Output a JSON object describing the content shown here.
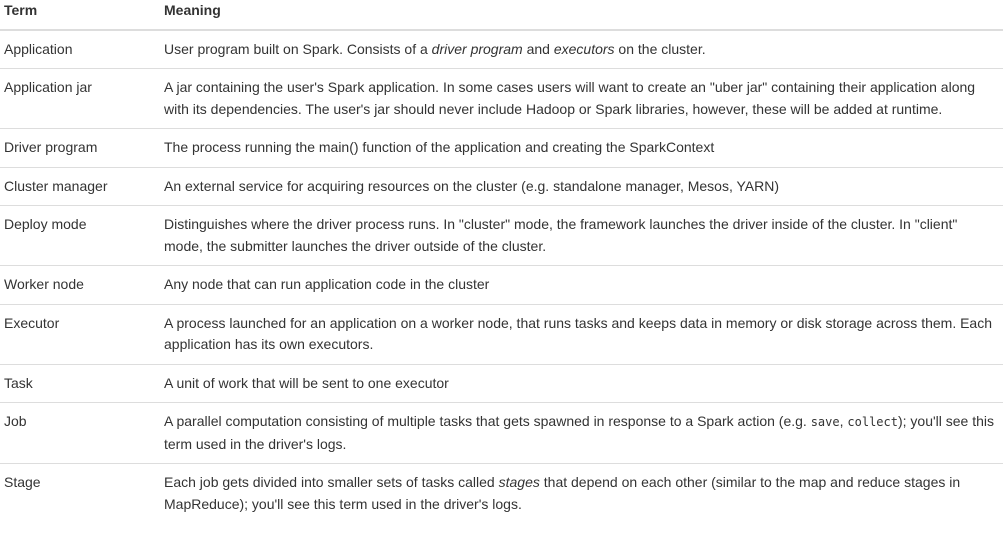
{
  "header": {
    "term": "Term",
    "meaning": "Meaning"
  },
  "rows": [
    {
      "term": "Application",
      "meaning": [
        {
          "text": "User program built on Spark. Consists of a "
        },
        {
          "text": "driver program",
          "em": true
        },
        {
          "text": " and "
        },
        {
          "text": "executors",
          "em": true
        },
        {
          "text": " on the cluster."
        }
      ]
    },
    {
      "term": "Application jar",
      "meaning": [
        {
          "text": "A jar containing the user's Spark application. In some cases users will want to create an \"uber jar\" containing their application along with its dependencies. The user's jar should never include Hadoop or Spark libraries, however, these will be added at runtime."
        }
      ]
    },
    {
      "term": "Driver program",
      "meaning": [
        {
          "text": "The process running the main() function of the application and creating the SparkContext"
        }
      ]
    },
    {
      "term": "Cluster manager",
      "meaning": [
        {
          "text": "An external service for acquiring resources on the cluster (e.g. standalone manager, Mesos, YARN)"
        }
      ]
    },
    {
      "term": "Deploy mode",
      "meaning": [
        {
          "text": "Distinguishes where the driver process runs. In \"cluster\" mode, the framework launches the driver inside of the cluster. In \"client\" mode, the submitter launches the driver outside of the cluster."
        }
      ]
    },
    {
      "term": "Worker node",
      "meaning": [
        {
          "text": "Any node that can run application code in the cluster"
        }
      ]
    },
    {
      "term": "Executor",
      "meaning": [
        {
          "text": "A process launched for an application on a worker node, that runs tasks and keeps data in memory or disk storage across them. Each application has its own executors."
        }
      ]
    },
    {
      "term": "Task",
      "meaning": [
        {
          "text": "A unit of work that will be sent to one executor"
        }
      ]
    },
    {
      "term": "Job",
      "meaning": [
        {
          "text": "A parallel computation consisting of multiple tasks that gets spawned in response to a Spark action (e.g. "
        },
        {
          "text": "save",
          "code": true
        },
        {
          "text": ", "
        },
        {
          "text": "collect",
          "code": true
        },
        {
          "text": "); you'll see this term used in the driver's logs."
        }
      ]
    },
    {
      "term": "Stage",
      "meaning": [
        {
          "text": "Each job gets divided into smaller sets of tasks called "
        },
        {
          "text": "stages",
          "em": true
        },
        {
          "text": " that depend on each other (similar to the map and reduce stages in MapReduce); you'll see this term used in the driver's logs."
        }
      ]
    }
  ]
}
